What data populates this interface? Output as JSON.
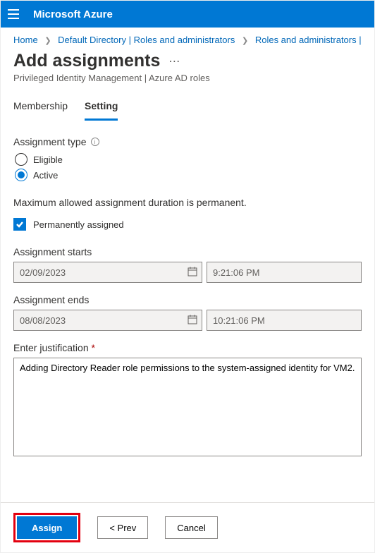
{
  "header": {
    "brand": "Microsoft Azure"
  },
  "breadcrumb": {
    "home": "Home",
    "dir": "Default Directory | Roles and administrators",
    "roles": "Roles and administrators |"
  },
  "page": {
    "title": "Add assignments",
    "subtitle": "Privileged Identity Management | Azure AD roles"
  },
  "tabs": {
    "membership": "Membership",
    "setting": "Setting"
  },
  "form": {
    "assignment_type_label": "Assignment type",
    "eligible_label": "Eligible",
    "active_label": "Active",
    "max_duration_text": "Maximum allowed assignment duration is permanent.",
    "perm_assigned_label": "Permanently assigned",
    "starts_label": "Assignment starts",
    "starts_date": "02/09/2023",
    "starts_time": "9:21:06 PM",
    "ends_label": "Assignment ends",
    "ends_date": "08/08/2023",
    "ends_time": "10:21:06 PM",
    "justification_label": "Enter justification",
    "justification_value": "Adding Directory Reader role permissions to the system-assigned identity for VM2."
  },
  "footer": {
    "assign": "Assign",
    "prev": "<  Prev",
    "cancel": "Cancel"
  }
}
